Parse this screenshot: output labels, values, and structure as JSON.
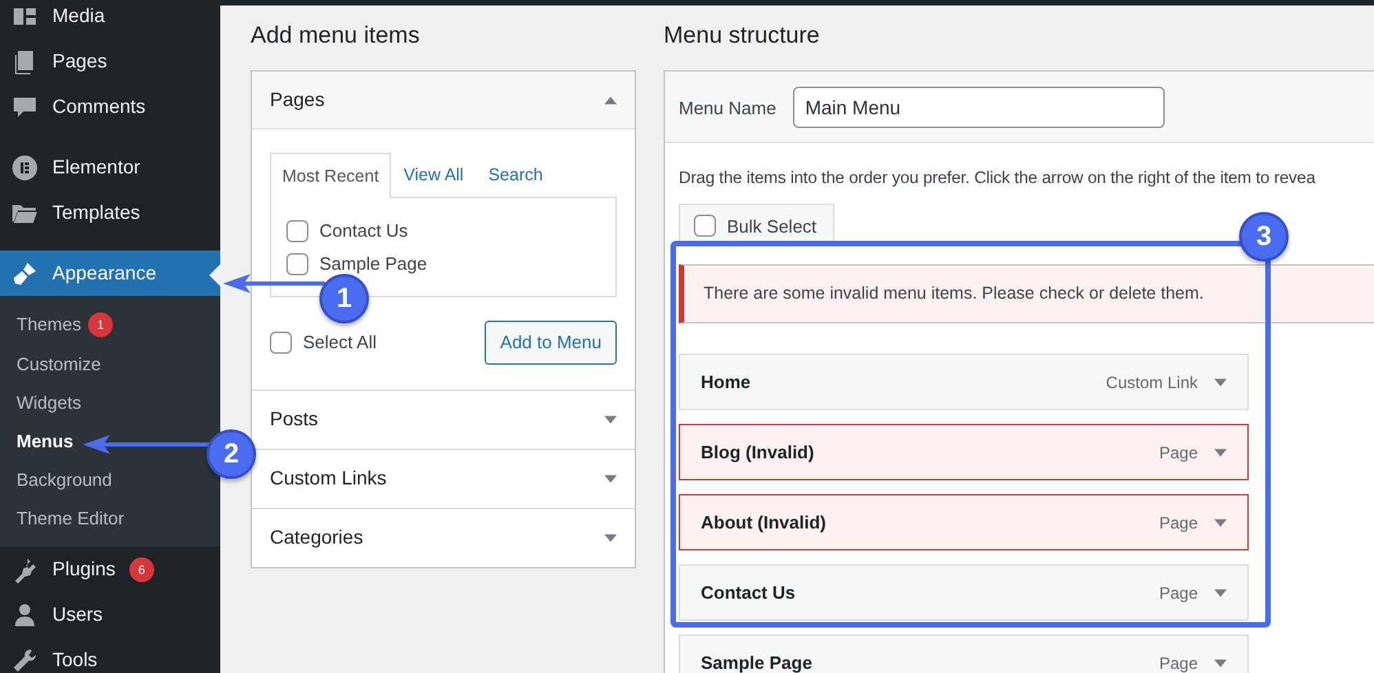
{
  "sidebar": {
    "items": [
      {
        "label": "Media",
        "kind": "main",
        "selected": false
      },
      {
        "label": "Pages",
        "kind": "main",
        "selected": false
      },
      {
        "label": "Comments",
        "kind": "main",
        "selected": false
      },
      {
        "kind": "gap"
      },
      {
        "label": "Elementor",
        "kind": "main",
        "selected": false
      },
      {
        "label": "Templates",
        "kind": "main",
        "selected": false
      },
      {
        "kind": "gap"
      },
      {
        "label": "Appearance",
        "kind": "main",
        "selected": true,
        "children": [
          {
            "label": "Themes",
            "selected": false,
            "badge": "1"
          },
          {
            "label": "Customize",
            "selected": false
          },
          {
            "label": "Widgets",
            "selected": false
          },
          {
            "label": "Menus",
            "selected": true
          },
          {
            "label": "Background",
            "selected": false
          },
          {
            "label": "Theme Editor",
            "selected": false
          }
        ]
      },
      {
        "label": "Plugins",
        "kind": "main",
        "selected": false,
        "badge": "6"
      },
      {
        "label": "Users",
        "kind": "main",
        "selected": false
      },
      {
        "label": "Tools",
        "kind": "main",
        "selected": false
      }
    ]
  },
  "add_menu_items": {
    "title": "Add menu items",
    "sections": [
      {
        "title": "Pages",
        "expanded": true,
        "tabs": [
          {
            "label": "Most Recent",
            "selected": true
          },
          {
            "label": "View All",
            "selected": false
          },
          {
            "label": "Search",
            "selected": false
          }
        ],
        "items": [
          {
            "label": "Contact Us",
            "checked": false
          },
          {
            "label": "Sample Page",
            "checked": false
          }
        ],
        "select_all": {
          "label": "Select All",
          "checked": false
        },
        "button": "Add to Menu"
      },
      {
        "title": "Posts",
        "expanded": false
      },
      {
        "title": "Custom Links",
        "expanded": false
      },
      {
        "title": "Categories",
        "expanded": false
      }
    ]
  },
  "menu_structure": {
    "title": "Menu structure",
    "menu_name": {
      "label": "Menu Name",
      "value": "Main Menu"
    },
    "instructions": "Drag the items into the order you prefer. Click the arrow on the right of the item to revea",
    "bulk_select": {
      "label": "Bulk Select",
      "checked": false
    },
    "notice": "There are some invalid menu items. Please check or delete them.",
    "items": [
      {
        "title": "Home",
        "type": "Custom Link",
        "invalid": false
      },
      {
        "title": "Blog (Invalid)",
        "type": "Page",
        "invalid": true
      },
      {
        "title": "About (Invalid)",
        "type": "Page",
        "invalid": true
      },
      {
        "title": "Contact Us",
        "type": "Page",
        "invalid": false
      },
      {
        "title": "Sample Page",
        "type": "Page",
        "invalid": false
      }
    ]
  },
  "annotations": [
    {
      "label": "1"
    },
    {
      "label": "2"
    },
    {
      "label": "3"
    }
  ]
}
